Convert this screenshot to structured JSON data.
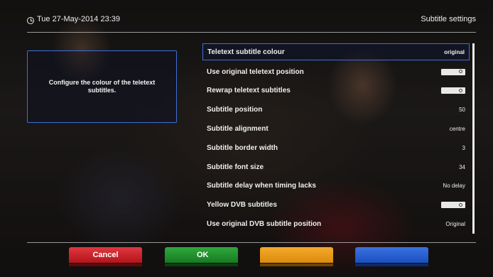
{
  "header": {
    "datetime": "Tue 27-May-2014 23:39",
    "title": "Subtitle settings",
    "clock_icon": "clock-icon"
  },
  "help": {
    "text": "Configure the colour of the teletext subtitles."
  },
  "settings": [
    {
      "label": "Teletext subtitle colour",
      "value": "original",
      "type": "text",
      "selected": true
    },
    {
      "label": "Use original teletext position",
      "value": "off",
      "type": "toggle"
    },
    {
      "label": "Rewrap teletext subtitles",
      "value": "off",
      "type": "toggle"
    },
    {
      "label": "Subtitle position",
      "value": "50",
      "type": "text"
    },
    {
      "label": "Subtitle alignment",
      "value": "centre",
      "type": "text"
    },
    {
      "label": "Subtitle border width",
      "value": "3",
      "type": "text"
    },
    {
      "label": "Subtitle font size",
      "value": "34",
      "type": "text"
    },
    {
      "label": "Subtitle delay when timing lacks",
      "value": "No delay",
      "type": "text"
    },
    {
      "label": "Yellow DVB subtitles",
      "value": "off",
      "type": "toggle"
    },
    {
      "label": "Use original DVB subtitle position",
      "value": "Original",
      "type": "text"
    }
  ],
  "buttons": {
    "red": "Cancel",
    "green": "OK",
    "yellow": "",
    "blue": ""
  },
  "colors": {
    "selection_border": "#3f6fd9",
    "red": "#d02a31",
    "green": "#25923a",
    "yellow": "#f0a020",
    "blue": "#2e63d6"
  }
}
